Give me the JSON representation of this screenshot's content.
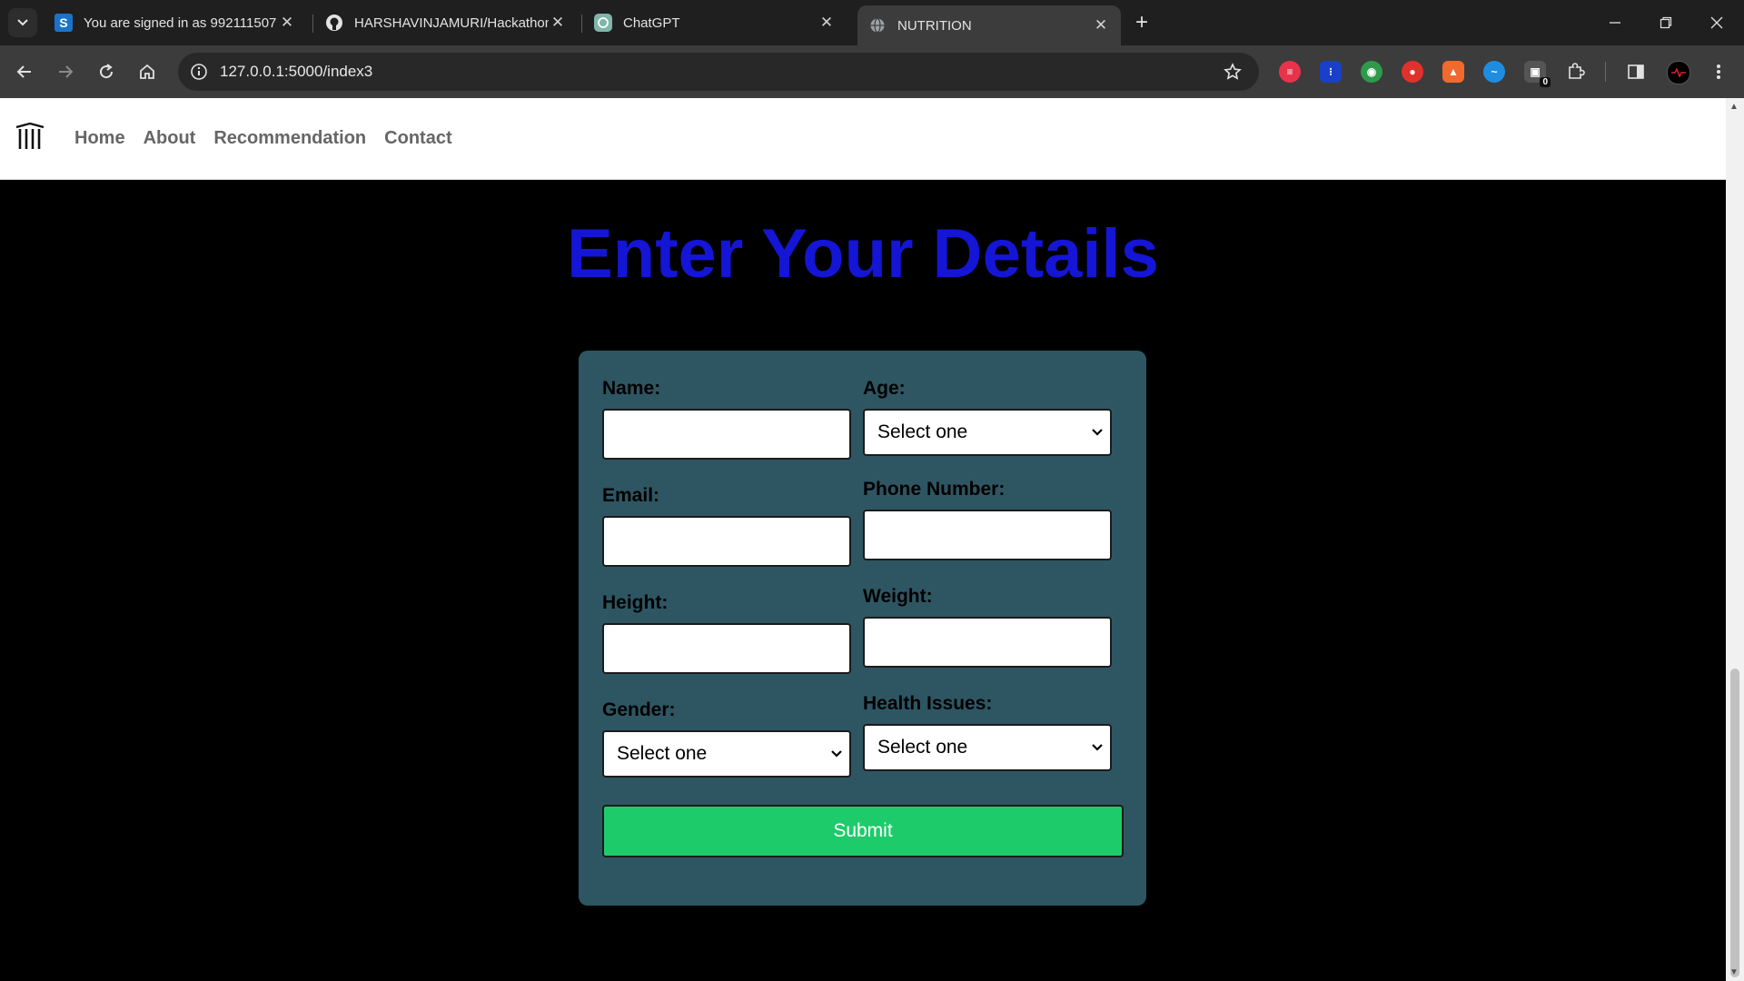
{
  "browser": {
    "tabs": [
      {
        "title": "You are signed in as 992111507",
        "icon": "s-app-icon"
      },
      {
        "title": "HARSHAVINJAMURI/Hackathon",
        "icon": "github-icon"
      },
      {
        "title": "ChatGPT",
        "icon": "chatgpt-icon"
      },
      {
        "title": "NUTRITION",
        "icon": "globe-icon"
      }
    ],
    "url": "127.0.0.1:5000/index3",
    "extension_badge": "0"
  },
  "site": {
    "nav": [
      "Home",
      "About",
      "Recommendation",
      "Contact"
    ]
  },
  "page": {
    "title": "Enter Your Details"
  },
  "form": {
    "name_label": "Name:",
    "age_label": "Age:",
    "age_value": "Select one",
    "email_label": "Email:",
    "phone_label": "Phone Number:",
    "height_label": "Height:",
    "weight_label": "Weight:",
    "gender_label": "Gender:",
    "gender_value": "Select one",
    "health_label": "Health Issues:",
    "health_value": "Select one",
    "submit_label": "Submit"
  },
  "colors": {
    "title": "#1515d6",
    "card": "#2e5662",
    "submit": "#1ecb6a"
  }
}
